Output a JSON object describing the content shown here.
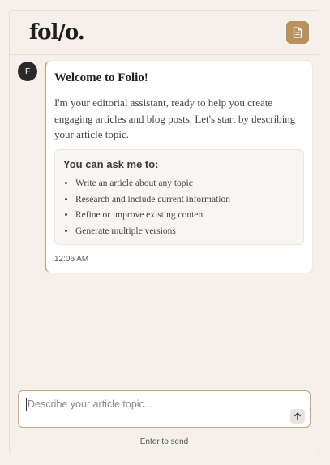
{
  "header": {
    "logo": "fol/o.",
    "doc_button_icon": "document-icon"
  },
  "message": {
    "avatar_initial": "F",
    "title": "Welcome to Folio!",
    "body": "I'm your editorial assistant, ready to help you create engaging articles and blog posts. Let's start by describing your article topic.",
    "capabilities_title": "You can ask me to:",
    "capabilities": [
      "Write an article about any topic",
      "Research and include current information",
      "Refine or improve existing content",
      "Generate multiple versions"
    ],
    "time": "12:06 AM"
  },
  "composer": {
    "placeholder": "Describe your article topic...",
    "value": "",
    "send_icon": "arrow-up-icon",
    "hint": "Enter to send"
  },
  "colors": {
    "accent": "#b8915f",
    "background": "#f5f1ea",
    "avatar": "#2a2a2a"
  }
}
